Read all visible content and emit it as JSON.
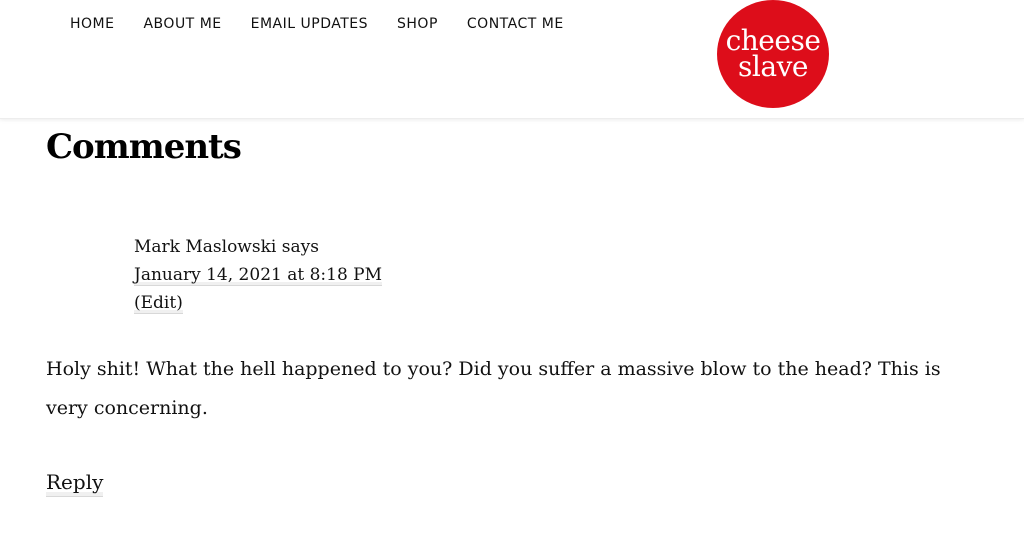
{
  "header": {
    "nav": [
      {
        "label": "HOME"
      },
      {
        "label": "ABOUT ME"
      },
      {
        "label": "EMAIL UPDATES"
      },
      {
        "label": "SHOP"
      },
      {
        "label": "CONTACT ME"
      }
    ],
    "logo": {
      "line1": "cheese",
      "line2": "slave",
      "color": "#dd0d1a"
    }
  },
  "comments": {
    "title": "Comments",
    "items": [
      {
        "author_line": "Mark Maslowski says",
        "date": "January 14, 2021 at 8:18 PM",
        "edit_label": "(Edit)",
        "body": "Holy shit! What the hell happened to you? Did you suffer a massive blow to the head? This is very concerning.",
        "reply_label": "Reply"
      }
    ]
  }
}
